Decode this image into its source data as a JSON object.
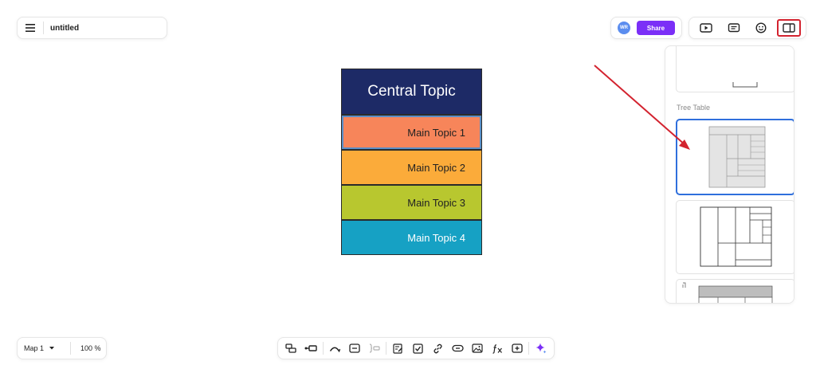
{
  "file": {
    "name": "untitled"
  },
  "collab": {
    "avatar_initials": "WR",
    "share_label": "Share"
  },
  "top_tools": [
    {
      "icon": "slideshow-icon"
    },
    {
      "icon": "comment-icon"
    },
    {
      "icon": "emoji-icon"
    },
    {
      "icon": "panel-icon",
      "active": true
    }
  ],
  "side_panel": {
    "tabs": [
      {
        "icon": "style-brush-icon"
      },
      {
        "icon": "slideshow-icon"
      },
      {
        "icon": "note-icon"
      },
      {
        "icon": "layout-icon",
        "active": true
      },
      {
        "icon": "theme-icon"
      }
    ],
    "section_label": "Tree Table"
  },
  "mindmap": {
    "central": "Central Topic",
    "topics": [
      "Main Topic 1",
      "Main Topic 2",
      "Main Topic 3",
      "Main Topic 4"
    ]
  },
  "map_bar": {
    "map_name": "Map 1",
    "zoom": "100 %"
  },
  "bottom_tools": [
    "topic-icon",
    "subtopic-icon",
    "relationship-icon",
    "boundary-icon",
    "summary-icon",
    "note-icon",
    "task-icon",
    "link-icon",
    "hyperlink-icon",
    "image-icon",
    "formula-icon",
    "insert-icon",
    "ai-sparkle-icon"
  ],
  "colors": {
    "central": "#1d2a66",
    "topic1": "#f7855a",
    "topic2": "#fbab3a",
    "topic3": "#b8c72f",
    "topic4": "#16a1c4",
    "share": "#7b2ff7",
    "highlight": "#d3232f"
  }
}
